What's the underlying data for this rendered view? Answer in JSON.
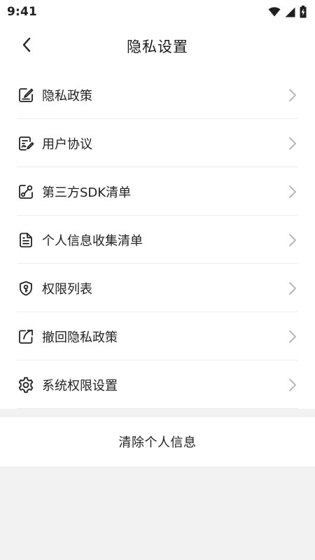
{
  "status_bar": {
    "time": "9:41",
    "icons": [
      "wifi-icon",
      "signal-icon",
      "battery-charging-icon"
    ]
  },
  "header": {
    "title": "隐私设置",
    "back_icon": "chevron-left-icon"
  },
  "menu": {
    "items": [
      {
        "label": "隐私政策",
        "icon": "document-pen-icon"
      },
      {
        "label": "用户协议",
        "icon": "signed-document-icon"
      },
      {
        "label": "第三方SDK清单",
        "icon": "share-nodes-icon"
      },
      {
        "label": "个人信息收集清单",
        "icon": "file-list-icon"
      },
      {
        "label": "权限列表",
        "icon": "shield-key-icon"
      },
      {
        "label": "撤回隐私政策",
        "icon": "share-arrow-icon"
      },
      {
        "label": "系统权限设置",
        "icon": "gear-icon"
      }
    ],
    "chevron_icon": "chevron-right-icon"
  },
  "actions": {
    "clear_label": "清除个人信息"
  },
  "colors": {
    "background": "#f2f2f2",
    "surface": "#ffffff",
    "text": "#222222",
    "divider": "#ededed",
    "chevron": "#b8b8b8"
  }
}
